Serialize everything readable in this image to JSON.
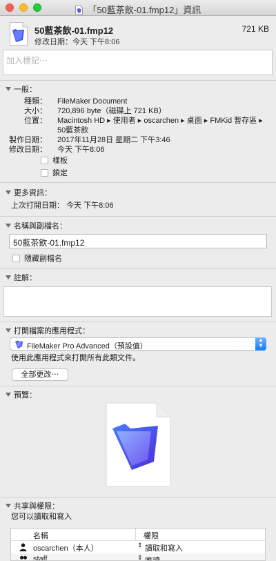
{
  "window": {
    "title": "「50藍茶飲-01.fmp12」資訊"
  },
  "header": {
    "file_name": "50藍茶飲-01.fmp12",
    "size": "721 KB",
    "modified_label": "修改日期：",
    "modified_value": "今天 下午8:06"
  },
  "tags": {
    "placeholder": "加入標記⋯"
  },
  "general": {
    "title": "一般：",
    "rows": [
      {
        "label": "種類：",
        "value": "FileMaker Document"
      },
      {
        "label": "大小：",
        "value": "720,896 byte（磁碟上 721 KB）"
      },
      {
        "label": "位置：",
        "value": "Macintosh HD ▸ 使用者 ▸ oscarchen ▸ 桌面 ▸ FMKid 暫存區 ▸",
        "value2": "50藍茶飲"
      },
      {
        "label": "製作日期：",
        "value": "2017年11月28日 星期二 下午3:46"
      },
      {
        "label": "修改日期：",
        "value": "今天 下午8:06"
      }
    ],
    "template_label": "樣板",
    "locked_label": "鎖定"
  },
  "more_info": {
    "title": "更多資訊：",
    "last_opened_label": "上次打開日期：",
    "last_opened_value": "今天 下午8:06"
  },
  "name_ext": {
    "title": "名稱與副檔名：",
    "value": "50藍茶飲-01.fmp12",
    "hide_ext_label": "隱藏副檔名"
  },
  "comments": {
    "title": "註解："
  },
  "open_with": {
    "title": "打開檔案的應用程式：",
    "app": "FileMaker Pro Advanced（預設值）",
    "note": "使用此應用程式來打開所有此類文件。",
    "change_all": "全部更改⋯"
  },
  "preview": {
    "title": "預覽："
  },
  "sharing": {
    "title": "共享與權限：",
    "note": "您可以讀取和寫入",
    "columns": [
      "名稱",
      "權限"
    ],
    "rows": [
      {
        "name": "oscarchen（本人）",
        "privilege": "讀取和寫入"
      },
      {
        "name": "staff",
        "privilege": "唯讀"
      }
    ]
  },
  "colors": {
    "accent": "#147efb",
    "background": "#ececec"
  }
}
